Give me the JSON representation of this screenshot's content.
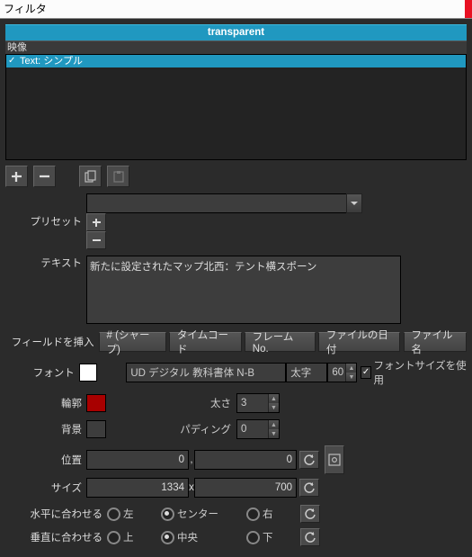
{
  "window": {
    "title": "フィルタ"
  },
  "header": {
    "name": "transparent",
    "section": "映像"
  },
  "list": {
    "items": [
      {
        "label": "Text: シンプル",
        "checked": true
      }
    ]
  },
  "toolbar": {
    "add": "+",
    "remove": "−"
  },
  "preset": {
    "label": "プリセット",
    "value": ""
  },
  "text": {
    "label": "テキスト",
    "value": "新たに設定されたマップ北西：テント横スポーン"
  },
  "insert": {
    "label": "フィールドを挿入",
    "sharp": "# (シャープ)",
    "timecode": "タイムコード",
    "frameno": "フレーム  No.",
    "filedate": "ファイルの日付",
    "filename": "ファイル名"
  },
  "font": {
    "label": "フォント",
    "family": "UD デジタル 教科書体 N-B",
    "weight": "太字",
    "size": "60",
    "use_size_label": "フォントサイズを使用"
  },
  "outline": {
    "label": "輪郭",
    "thickness_label": "太さ",
    "thickness": "3"
  },
  "bg": {
    "label": "背景",
    "padding_label": "パディング",
    "padding": "0"
  },
  "pos": {
    "label": "位置",
    "x": "0",
    "y": "0"
  },
  "size": {
    "label": "サイズ",
    "w": "1334",
    "h": "700"
  },
  "halign": {
    "label": "水平に合わせる",
    "left": "左",
    "center": "センター",
    "right": "右",
    "value": "center"
  },
  "valign": {
    "label": "垂直に合わせる",
    "top": "上",
    "middle": "中央",
    "bottom": "下",
    "value": "middle"
  }
}
